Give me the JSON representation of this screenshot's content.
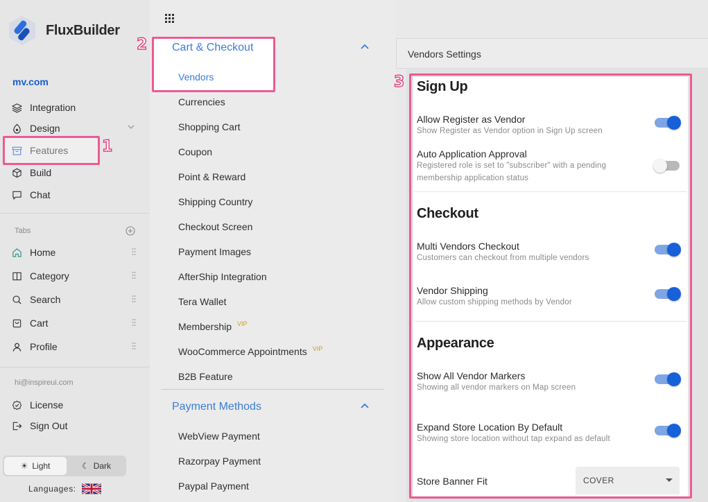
{
  "brand": "FluxBuilder",
  "site": "mv.com",
  "nav": [
    {
      "label": "Integration",
      "icon": "layers-icon"
    },
    {
      "label": "Design",
      "icon": "palette-icon"
    },
    {
      "label": "Features",
      "icon": "archive-icon"
    },
    {
      "label": "Build",
      "icon": "cube-icon"
    },
    {
      "label": "Chat",
      "icon": "chat-icon"
    }
  ],
  "tabs_label": "Tabs",
  "tabs": [
    {
      "label": "Home",
      "icon": "home-icon"
    },
    {
      "label": "Category",
      "icon": "columns-icon"
    },
    {
      "label": "Search",
      "icon": "search-icon"
    },
    {
      "label": "Cart",
      "icon": "cart-icon"
    },
    {
      "label": "Profile",
      "icon": "user-icon"
    }
  ],
  "account_email": "hi@inspireui.com",
  "account": [
    {
      "label": "License",
      "icon": "verified-icon"
    },
    {
      "label": "Sign Out",
      "icon": "sign-out-icon"
    }
  ],
  "theme": {
    "light": "Light",
    "dark": "Dark",
    "selected": "Light"
  },
  "languages_label": "Languages:",
  "language_flag": "uk-flag-icon",
  "annotations": [
    "1",
    "2",
    "3"
  ],
  "middle": {
    "cart_section": "Cart & Checkout",
    "cart_items": [
      {
        "label": "Vendors",
        "selected": true
      },
      {
        "label": "Currencies"
      },
      {
        "label": "Shopping Cart"
      },
      {
        "label": "Coupon"
      },
      {
        "label": "Point & Reward"
      },
      {
        "label": "Shipping Country"
      },
      {
        "label": "Checkout Screen"
      },
      {
        "label": "Payment Images"
      },
      {
        "label": "AfterShip Integration"
      },
      {
        "label": "Tera Wallet"
      },
      {
        "label": "Membership",
        "vip": "VIP"
      },
      {
        "label": "WooCommerce Appointments",
        "vip": "VIP"
      },
      {
        "label": "B2B Feature"
      }
    ],
    "payment_section": "Payment Methods",
    "payment_items": [
      {
        "label": "WebView Payment"
      },
      {
        "label": "Razorpay Payment"
      },
      {
        "label": "Paypal Payment"
      }
    ]
  },
  "settings": {
    "header": "Vendors Settings",
    "signup_title": "Sign Up",
    "checkout_title": "Checkout",
    "appearance_title": "Appearance",
    "items": [
      {
        "title": "Allow Register as Vendor",
        "desc": "Show Register as Vendor option in Sign Up screen",
        "on": true
      },
      {
        "title": "Auto Application Approval",
        "desc": "Registered role is set to \"subscriber\" with a pending membership application status",
        "on": false
      },
      {
        "title": "Multi Vendors Checkout",
        "desc": "Customers can checkout from multiple vendors",
        "on": true
      },
      {
        "title": "Vendor Shipping",
        "desc": "Allow custom shipping methods by Vendor",
        "on": true
      },
      {
        "title": "Show All Vendor Markers",
        "desc": "Showing all vendor markers on Map screen",
        "on": true
      },
      {
        "title": "Expand Store Location By Default",
        "desc": "Showing store location without tap expand as default",
        "on": true
      }
    ],
    "banner_fit_label": "Store Banner Fit",
    "banner_fit_value": "COVER"
  },
  "colors": {
    "accent": "#1660d9",
    "link": "#3a7ed8",
    "annotation": "#ec5a93"
  }
}
